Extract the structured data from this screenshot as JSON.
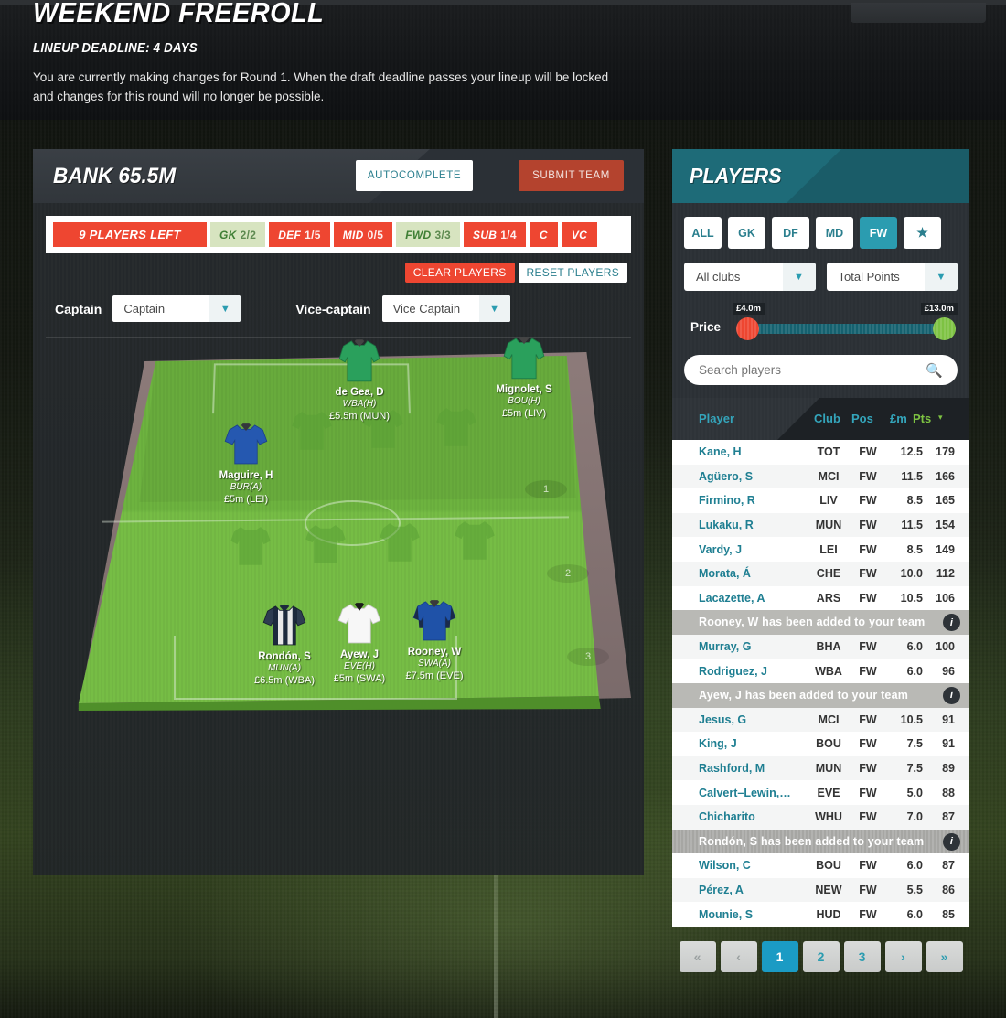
{
  "banner": {
    "title": "WEEKEND FREEROLL",
    "deadline": "LINEUP DEADLINE: 4 DAYS",
    "description": "You are currently making changes for Round 1. When the draft deadline passes your lineup will be locked and changes for this round will no longer be possible."
  },
  "team": {
    "bank_label": "BANK 65.5M",
    "autocomplete_label": "AUTOCOMPLETE",
    "submit_label": "SUBMIT TEAM",
    "clear_label": "CLEAR PLAYERS",
    "reset_label": "RESET PLAYERS",
    "status": {
      "players_left": "9 PLAYERS LEFT",
      "gk_label": "GK",
      "gk_count": "2/2",
      "def_label": "DEF",
      "def_count": "1/5",
      "mid_label": "MID",
      "mid_count": "0/5",
      "fwd_label": "FWD",
      "fwd_count": "3/3",
      "sub_label": "SUB",
      "sub_count": "1/4",
      "c_label": "C",
      "vc_label": "VC"
    },
    "captain_label": "Captain",
    "captain_value": "Captain",
    "vice_label": "Vice-captain",
    "vice_value": "Vice Captain",
    "bench_slots": [
      "1",
      "2",
      "3"
    ],
    "pitch_players": [
      {
        "name": "de Gea, D",
        "fixture": "WBA(H)",
        "price": "£5.5m (MUN)",
        "kit": "gk-green"
      },
      {
        "name": "Mignolet, S",
        "fixture": "BOU(H)",
        "price": "£5m (LIV)",
        "kit": "gk-green"
      },
      {
        "name": "Maguire, H",
        "fixture": "BUR(A)",
        "price": "£5m (LEI)",
        "kit": "blue-royal"
      },
      {
        "name": "Rondón, S",
        "fixture": "MUN(A)",
        "price": "£6.5m (WBA)",
        "kit": "stripes-navy"
      },
      {
        "name": "Ayew, J",
        "fixture": "EVE(H)",
        "price": "£5m (SWA)",
        "kit": "white"
      },
      {
        "name": "Rooney, W",
        "fixture": "SWA(A)",
        "price": "£7.5m (EVE)",
        "kit": "blue-dark"
      }
    ]
  },
  "players_panel": {
    "title": "PLAYERS",
    "position_tabs": [
      {
        "label": "ALL",
        "active": false
      },
      {
        "label": "GK",
        "active": false
      },
      {
        "label": "DF",
        "active": false
      },
      {
        "label": "MD",
        "active": false
      },
      {
        "label": "FW",
        "active": true
      },
      {
        "label": "★",
        "active": false
      }
    ],
    "club_filter": "All clubs",
    "sort_filter": "Total Points",
    "price_label": "Price",
    "price_min": "£4.0m",
    "price_max": "£13.0m",
    "search_placeholder": "Search players",
    "search_value": "",
    "search_icon": "search-icon",
    "columns": {
      "player": "Player",
      "club": "Club",
      "pos": "Pos",
      "fm": "£m",
      "pts": "Pts"
    },
    "sort_indicator": "▾",
    "rows": [
      {
        "type": "player",
        "name": "Kane, H",
        "club": "TOT",
        "pos": "FW",
        "fm": "12.5",
        "pts": "179"
      },
      {
        "type": "player",
        "name": "Agüero, S",
        "club": "MCI",
        "pos": "FW",
        "fm": "11.5",
        "pts": "166"
      },
      {
        "type": "player",
        "name": "Firmino, R",
        "club": "LIV",
        "pos": "FW",
        "fm": "8.5",
        "pts": "165"
      },
      {
        "type": "player",
        "name": "Lukaku, R",
        "club": "MUN",
        "pos": "FW",
        "fm": "11.5",
        "pts": "154"
      },
      {
        "type": "player",
        "name": "Vardy, J",
        "club": "LEI",
        "pos": "FW",
        "fm": "8.5",
        "pts": "149"
      },
      {
        "type": "player",
        "name": "Morata, Á",
        "club": "CHE",
        "pos": "FW",
        "fm": "10.0",
        "pts": "112"
      },
      {
        "type": "player",
        "name": "Lacazette, A",
        "club": "ARS",
        "pos": "FW",
        "fm": "10.5",
        "pts": "106"
      },
      {
        "type": "notice",
        "text": "Rooney, W has been added to your team",
        "info": "i"
      },
      {
        "type": "player",
        "name": "Murray, G",
        "club": "BHA",
        "pos": "FW",
        "fm": "6.0",
        "pts": "100"
      },
      {
        "type": "player",
        "name": "Rodriguez, J",
        "club": "WBA",
        "pos": "FW",
        "fm": "6.0",
        "pts": "96"
      },
      {
        "type": "notice",
        "text": "Ayew, J has been added to your team",
        "info": "i"
      },
      {
        "type": "player",
        "name": "Jesus, G",
        "club": "MCI",
        "pos": "FW",
        "fm": "10.5",
        "pts": "91"
      },
      {
        "type": "player",
        "name": "King, J",
        "club": "BOU",
        "pos": "FW",
        "fm": "7.5",
        "pts": "91"
      },
      {
        "type": "player",
        "name": "Rashford, M",
        "club": "MUN",
        "pos": "FW",
        "fm": "7.5",
        "pts": "89"
      },
      {
        "type": "player",
        "name": "Calvert–Lewin,…",
        "club": "EVE",
        "pos": "FW",
        "fm": "5.0",
        "pts": "88"
      },
      {
        "type": "player",
        "name": "Chicharito",
        "club": "WHU",
        "pos": "FW",
        "fm": "7.0",
        "pts": "87"
      },
      {
        "type": "notice",
        "text": "Rondón, S has been added to your team",
        "info": "i"
      },
      {
        "type": "player",
        "name": "Wilson, C",
        "club": "BOU",
        "pos": "FW",
        "fm": "6.0",
        "pts": "87"
      },
      {
        "type": "player",
        "name": "Pérez, A",
        "club": "NEW",
        "pos": "FW",
        "fm": "5.5",
        "pts": "86"
      },
      {
        "type": "player",
        "name": "Mounie, S",
        "club": "HUD",
        "pos": "FW",
        "fm": "6.0",
        "pts": "85"
      }
    ],
    "pagination": [
      {
        "label": "«",
        "name": "first-page",
        "active": false,
        "muted": true
      },
      {
        "label": "‹",
        "name": "prev-page",
        "active": false,
        "muted": true
      },
      {
        "label": "1",
        "name": "page-1",
        "active": true,
        "muted": false
      },
      {
        "label": "2",
        "name": "page-2",
        "active": false,
        "muted": false
      },
      {
        "label": "3",
        "name": "page-3",
        "active": false,
        "muted": false
      },
      {
        "label": "›",
        "name": "next-page",
        "active": false,
        "muted": false
      },
      {
        "label": "»",
        "name": "last-page",
        "active": false,
        "muted": false
      }
    ]
  },
  "colors": {
    "accent_teal": "#2b9cb0",
    "danger_red": "#ee4631",
    "ok_green": "#7dc242",
    "submit_red": "#b4432e",
    "panel_dark": "#2b3035"
  }
}
